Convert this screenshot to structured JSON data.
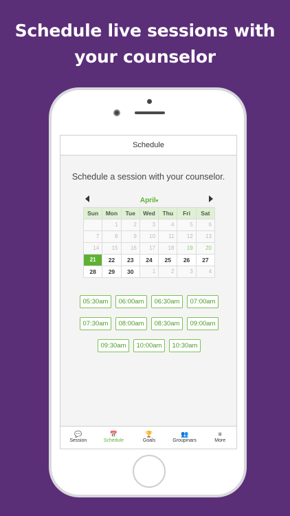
{
  "headline": {
    "line1": "Schedule live sessions with",
    "line2": "your counselor"
  },
  "screen": {
    "title": "Schedule",
    "prompt": "Schedule a session with your counselor."
  },
  "calendar": {
    "month": "April",
    "caret": "▾",
    "weekdays": [
      "Sun",
      "Mon",
      "Tue",
      "Wed",
      "Thu",
      "Fri",
      "Sat"
    ],
    "weeks": [
      [
        "",
        "1",
        "2",
        "3",
        "4",
        "5",
        "6"
      ],
      [
        "7",
        "8",
        "9",
        "10",
        "11",
        "12",
        "13"
      ],
      [
        "14",
        "15",
        "16",
        "17",
        "18",
        "19",
        "20"
      ],
      [
        "21",
        "22",
        "23",
        "24",
        "25",
        "26",
        "27"
      ],
      [
        "28",
        "29",
        "30",
        "1",
        "2",
        "3",
        "4"
      ]
    ],
    "selected_day": "21"
  },
  "time_slots": [
    [
      "05:30am",
      "06:00am",
      "06:30am",
      "07:00am"
    ],
    [
      "07:30am",
      "08:00am",
      "08:30am",
      "09:00am"
    ],
    [
      "09:30am",
      "10:00am",
      "10:30am"
    ]
  ],
  "tabs": [
    {
      "label": "Session",
      "icon": "chat-icon",
      "glyph": "💬"
    },
    {
      "label": "Schedule",
      "icon": "calendar-icon",
      "glyph": "📅"
    },
    {
      "label": "Goals",
      "icon": "trophy-icon",
      "glyph": "🏆"
    },
    {
      "label": "Groupinars",
      "icon": "group-icon",
      "glyph": "👥"
    },
    {
      "label": "More",
      "icon": "menu-icon",
      "glyph": "≡"
    }
  ],
  "active_tab": "Schedule",
  "colors": {
    "background": "#5b2e78",
    "accent": "#5fb133"
  }
}
